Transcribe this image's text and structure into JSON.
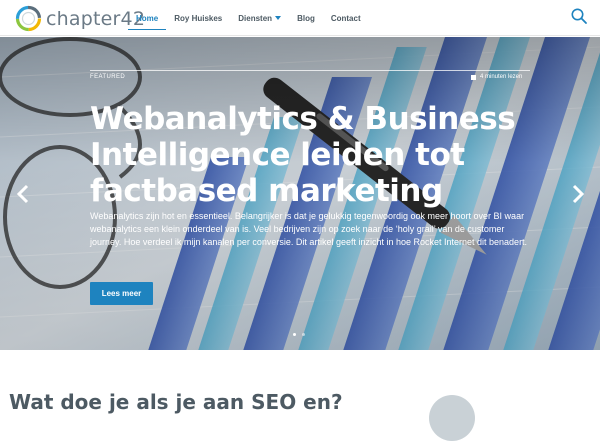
{
  "brand": {
    "name": "chapter42"
  },
  "nav": {
    "items": [
      {
        "label": "Home",
        "active": true
      },
      {
        "label": "Roy Huiskes"
      },
      {
        "label": "Diensten",
        "has_dropdown": true
      },
      {
        "label": "Blog"
      },
      {
        "label": "Contact"
      }
    ]
  },
  "icons": {
    "search": "search-icon",
    "prev": "chevron-left-icon",
    "next": "chevron-right-icon",
    "clock": "clock-icon"
  },
  "colors": {
    "accent": "#1e83bf",
    "nav_text": "#4d5a63",
    "logo_text": "#6b7a86"
  },
  "hero": {
    "tag": "Featured",
    "read_time": "4 minuten lezen",
    "title": "Webanalytics & Business Intelligence leiden tot factbased marketing",
    "description": "Webanalytics zijn hot en essentieel. Belangrijker is dat je gelukkig tegenwoordig ook meer hoort over BI waar webanalytics een klein onderdeel van is. Veel bedrijven zijn op zoek naar de ‘holy grail’ van de customer journey. Hoe verdeel ik mijn kanalen per conversie. Dit artikel geeft inzicht in hoe Rocket Internet dit benadert.",
    "button_label": "Lees meer",
    "slides_total": 2,
    "slides_active": 1
  },
  "next_section": {
    "title_partial": "Wat doe je als je aan SEO en?"
  }
}
